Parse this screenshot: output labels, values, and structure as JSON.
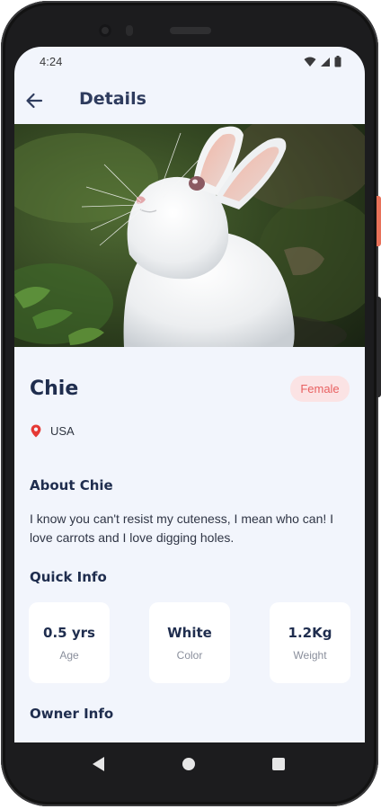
{
  "status_bar": {
    "time": "4:24",
    "icons": [
      "wifi-icon",
      "cell-signal-icon",
      "battery-icon"
    ]
  },
  "app_bar": {
    "back_icon": "arrow-left-icon",
    "title": "Details"
  },
  "pet": {
    "name": "Chie",
    "gender": "Female",
    "location": "USA",
    "location_icon": "location-pin-icon"
  },
  "about": {
    "title": "About Chie",
    "text": "I know you can't resist my cuteness, I mean who can! I love carrots and I love digging holes."
  },
  "quick_info": {
    "title": "Quick Info",
    "items": [
      {
        "value": "0.5 yrs",
        "label": "Age"
      },
      {
        "value": "White",
        "label": "Color"
      },
      {
        "value": "1.2Kg",
        "label": "Weight"
      }
    ]
  },
  "owner_info": {
    "title": "Owner Info"
  },
  "nav": {
    "icons": [
      "back-triangle-icon",
      "home-circle-icon",
      "recents-square-icon"
    ]
  },
  "colors": {
    "screen_bg": "#f2f5fc",
    "heading": "#1f2d4e",
    "app_title": "#2f3c5e",
    "badge_bg": "#fbe3e4",
    "badge_text": "#e86060",
    "pin": "#e53935",
    "card_bg": "#ffffff"
  }
}
